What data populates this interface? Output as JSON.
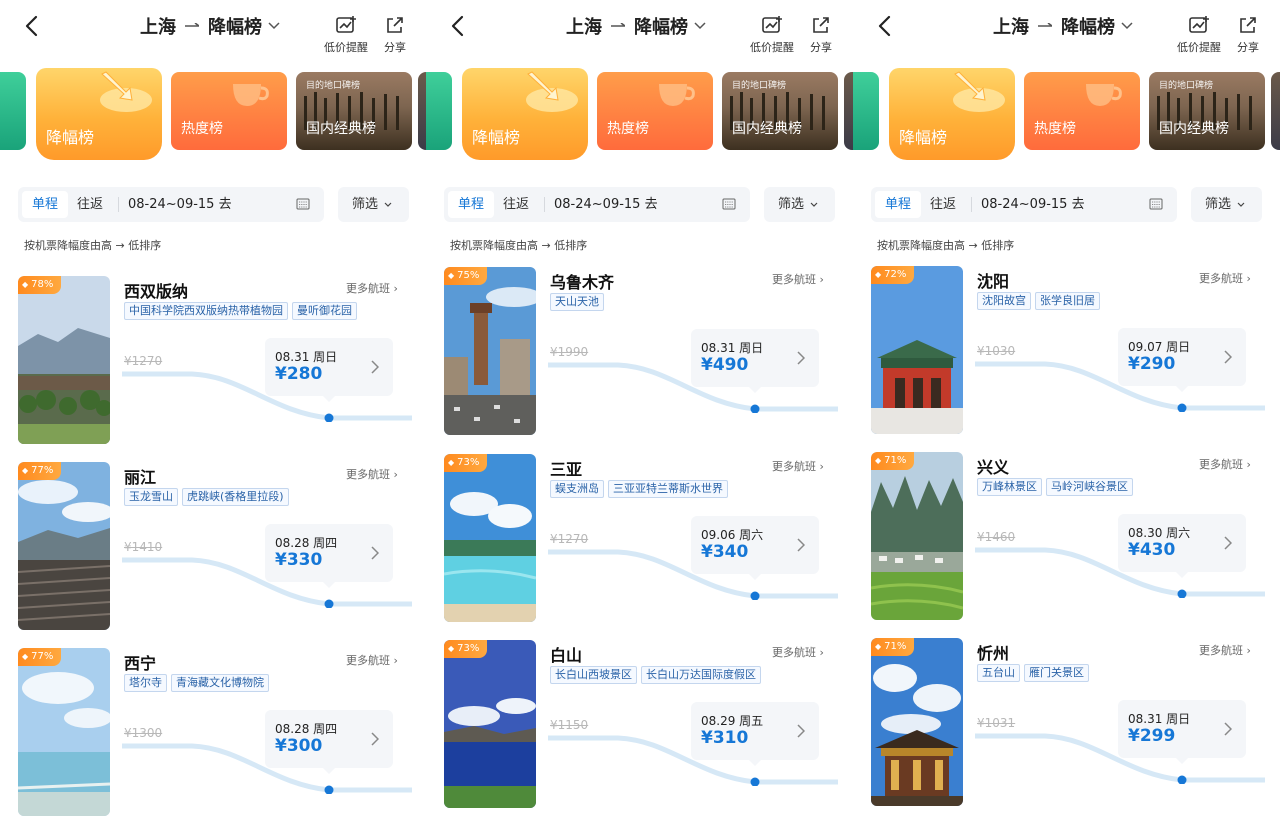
{
  "colors": {
    "accent": "#1677d6",
    "badge": "#ff8a1e",
    "tag_text": "#2a63a8"
  },
  "panels": [
    {
      "header": {
        "origin": "上海",
        "title": "降幅榜",
        "alert_label": "低价提醒",
        "share_label": "分享"
      },
      "banners": {
        "drop": "降幅榜",
        "hot": "热度榜",
        "classic": "国内经典榜",
        "classic_tag": "目的地口碑榜"
      },
      "tabs": {
        "oneway": "单程",
        "round": "往返"
      },
      "date_range": "08-24~09-15 去",
      "filter_label": "筛选",
      "sort_note": "按机票降幅度由高 → 低排序",
      "items": [
        {
          "badge": "78%",
          "city": "西双版纳",
          "more": "更多航班",
          "tags": [
            "中国科学院西双版纳热带植物园",
            "曼听御花园"
          ],
          "orig": "¥1270",
          "date": "08.31 周日",
          "price": "¥280"
        },
        {
          "badge": "77%",
          "city": "丽江",
          "more": "更多航班",
          "tags": [
            "玉龙雪山",
            "虎跳峡(香格里拉段)"
          ],
          "orig": "¥1410",
          "date": "08.28 周四",
          "price": "¥330"
        },
        {
          "badge": "77%",
          "city": "西宁",
          "more": "更多航班",
          "tags": [
            "塔尔寺",
            "青海藏文化博物院"
          ],
          "orig": "¥1300",
          "date": "08.28 周四",
          "price": "¥300"
        }
      ]
    },
    {
      "header": {
        "origin": "上海",
        "title": "降幅榜",
        "alert_label": "低价提醒",
        "share_label": "分享"
      },
      "banners": {
        "drop": "降幅榜",
        "hot": "热度榜",
        "classic": "国内经典榜",
        "classic_tag": "目的地口碑榜"
      },
      "tabs": {
        "oneway": "单程",
        "round": "往返"
      },
      "date_range": "08-24~09-15 去",
      "filter_label": "筛选",
      "sort_note": "按机票降幅度由高 → 低排序",
      "items": [
        {
          "badge": "75%",
          "city": "乌鲁木齐",
          "more": "更多航班",
          "tags": [
            "天山天池"
          ],
          "orig": "¥1990",
          "date": "08.31 周日",
          "price": "¥490"
        },
        {
          "badge": "73%",
          "city": "三亚",
          "more": "更多航班",
          "tags": [
            "蜈支洲岛",
            "三亚亚特兰蒂斯水世界"
          ],
          "orig": "¥1270",
          "date": "09.06 周六",
          "price": "¥340"
        },
        {
          "badge": "73%",
          "city": "白山",
          "more": "更多航班",
          "tags": [
            "长白山西坡景区",
            "长白山万达国际度假区"
          ],
          "orig": "¥1150",
          "date": "08.29 周五",
          "price": "¥310"
        }
      ]
    },
    {
      "header": {
        "origin": "上海",
        "title": "降幅榜",
        "alert_label": "低价提醒",
        "share_label": "分享"
      },
      "banners": {
        "drop": "降幅榜",
        "hot": "热度榜",
        "classic": "国内经典榜",
        "classic_tag": "目的地口碑榜"
      },
      "tabs": {
        "oneway": "单程",
        "round": "往返"
      },
      "date_range": "08-24~09-15 去",
      "filter_label": "筛选",
      "sort_note": "按机票降幅度由高 → 低排序",
      "items": [
        {
          "badge": "72%",
          "city": "沈阳",
          "more": "更多航班",
          "tags": [
            "沈阳故宫",
            "张学良旧居"
          ],
          "orig": "¥1030",
          "date": "09.07 周日",
          "price": "¥290"
        },
        {
          "badge": "71%",
          "city": "兴义",
          "more": "更多航班",
          "tags": [
            "万峰林景区",
            "马岭河峡谷景区"
          ],
          "orig": "¥1460",
          "date": "08.30 周六",
          "price": "¥430"
        },
        {
          "badge": "71%",
          "city": "忻州",
          "more": "更多航班",
          "tags": [
            "五台山",
            "雁门关景区"
          ],
          "orig": "¥1031",
          "date": "08.31 周日",
          "price": "¥299"
        }
      ]
    }
  ]
}
